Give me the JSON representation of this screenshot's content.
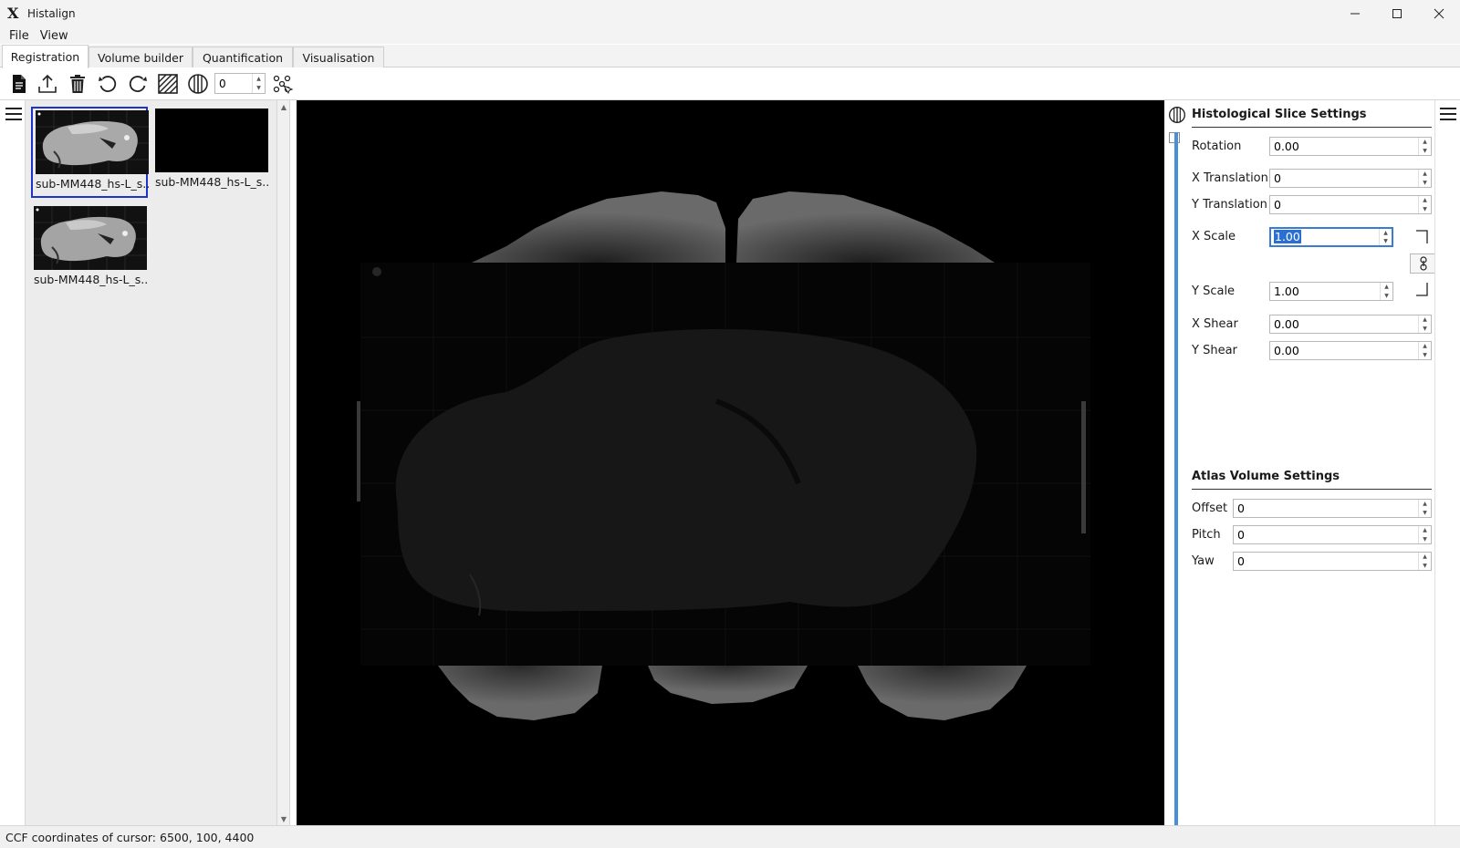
{
  "window": {
    "title": "Histalign",
    "logo_icon": "histalign-logo",
    "controls": [
      "minimize-icon",
      "maximize-icon",
      "close-icon"
    ]
  },
  "menu": {
    "items": [
      "File",
      "View"
    ]
  },
  "tabs": [
    {
      "label": "Registration",
      "active": true
    },
    {
      "label": "Volume builder",
      "active": false
    },
    {
      "label": "Quantification",
      "active": false
    },
    {
      "label": "Visualisation",
      "active": false
    }
  ],
  "toolbar": {
    "icons": [
      "open-project-icon",
      "upload-icon",
      "delete-icon",
      "rotate-left-icon",
      "rotate-right-icon",
      "hatch-toggle-icon",
      "contrast-icon",
      "landmark-icon"
    ],
    "spin_value": "0"
  },
  "thumbnails": [
    {
      "caption": "sub-MM448_hs-L_s...",
      "selected": true,
      "has_image": true
    },
    {
      "caption": "sub-MM448_hs-L_s...",
      "selected": false,
      "has_image": false
    },
    {
      "caption": "sub-MM448_hs-L_s...",
      "selected": false,
      "has_image": true
    }
  ],
  "histology": {
    "title": "Histological Slice Settings",
    "icon": "contrast-icon",
    "fields": {
      "rotation": {
        "label": "Rotation",
        "value": "0.00"
      },
      "x_translation": {
        "label": "X Translation",
        "value": "0"
      },
      "y_translation": {
        "label": "Y Translation",
        "value": "0"
      },
      "x_scale": {
        "label": "X Scale",
        "value": "1.00"
      },
      "y_scale": {
        "label": "Y Scale",
        "value": "1.00"
      },
      "x_shear": {
        "label": "X Shear",
        "value": "0.00"
      },
      "y_shear": {
        "label": "Y Shear",
        "value": "0.00"
      }
    }
  },
  "atlas": {
    "title": "Atlas Volume Settings",
    "fields": {
      "offset": {
        "label": "Offset",
        "value": "0"
      },
      "pitch": {
        "label": "Pitch",
        "value": "0"
      },
      "yaw": {
        "label": "Yaw",
        "value": "0"
      }
    }
  },
  "status": {
    "text": "CCF coordinates of cursor: 6500, 100, 4400"
  },
  "colors": {
    "accent": "#4a90d9",
    "selection": "#1d34c8",
    "viewer_bg": "#000000"
  }
}
